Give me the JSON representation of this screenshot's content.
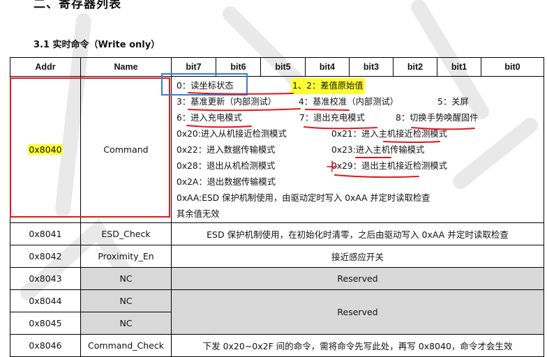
{
  "heading": "二、寄存器列表",
  "subheading": "3.1 实时命令（Write only）",
  "table": {
    "headers": [
      "Addr",
      "Name",
      "bit7",
      "bit6",
      "bit5",
      "bit4",
      "bit3",
      "bit2",
      "bit1",
      "bit0"
    ],
    "command_row": {
      "addr": "0x8040",
      "name": "Command",
      "lines": [
        [
          "0：读坐标状态",
          "1、2：差值原始值"
        ],
        [
          "3：基准更新（内部测试）",
          "4：基准校准（内部测试）",
          "5：关屏"
        ],
        [
          "6：进入充电模式",
          "7：退出充电模式",
          "8：切换手势唤醒固件"
        ],
        [
          "0x20:进入从机接近检测模式",
          "0x21：进入主机接近检测模式"
        ],
        [
          "0x22：进入数据传输模式",
          "0x23:进入主机传输模式"
        ],
        [
          "0x28：退出从机检测模式",
          "0x29：退出主机接近检测模式"
        ],
        [
          "0x2A：退出数据传输模式"
        ],
        [
          "0xAA:ESD 保护机制使用，由驱动定时写入 0xAA 并定时读取检查"
        ],
        [
          "其余值无效"
        ]
      ]
    },
    "rows": [
      {
        "addr": "0x8041",
        "name": "ESD_Check",
        "desc": "ESD 保护机制使用，在初始化时清零，之后由驱动写入 0xAA 并定时读取检查"
      },
      {
        "addr": "0x8042",
        "name": "Proximity_En",
        "desc": "接近感应开关"
      },
      {
        "addr": "0x8043",
        "name": "NC",
        "desc": "Reserved"
      },
      {
        "addr": "0x8044",
        "name": "NC",
        "desc": "Reserved"
      },
      {
        "addr": "0x8045",
        "name": "NC"
      },
      {
        "addr": "0x8046",
        "name": "Command_Check",
        "desc": "下发 0x20~0x2F 间的命令，需将命令先写此处，再写 0x8040，命令才会生效"
      }
    ]
  },
  "colors": {
    "highlight": "#ffff33",
    "annotation_red": "#e8141b",
    "annotation_blue": "#2f7fe0",
    "reserved_gray": "#d9d9d9"
  }
}
